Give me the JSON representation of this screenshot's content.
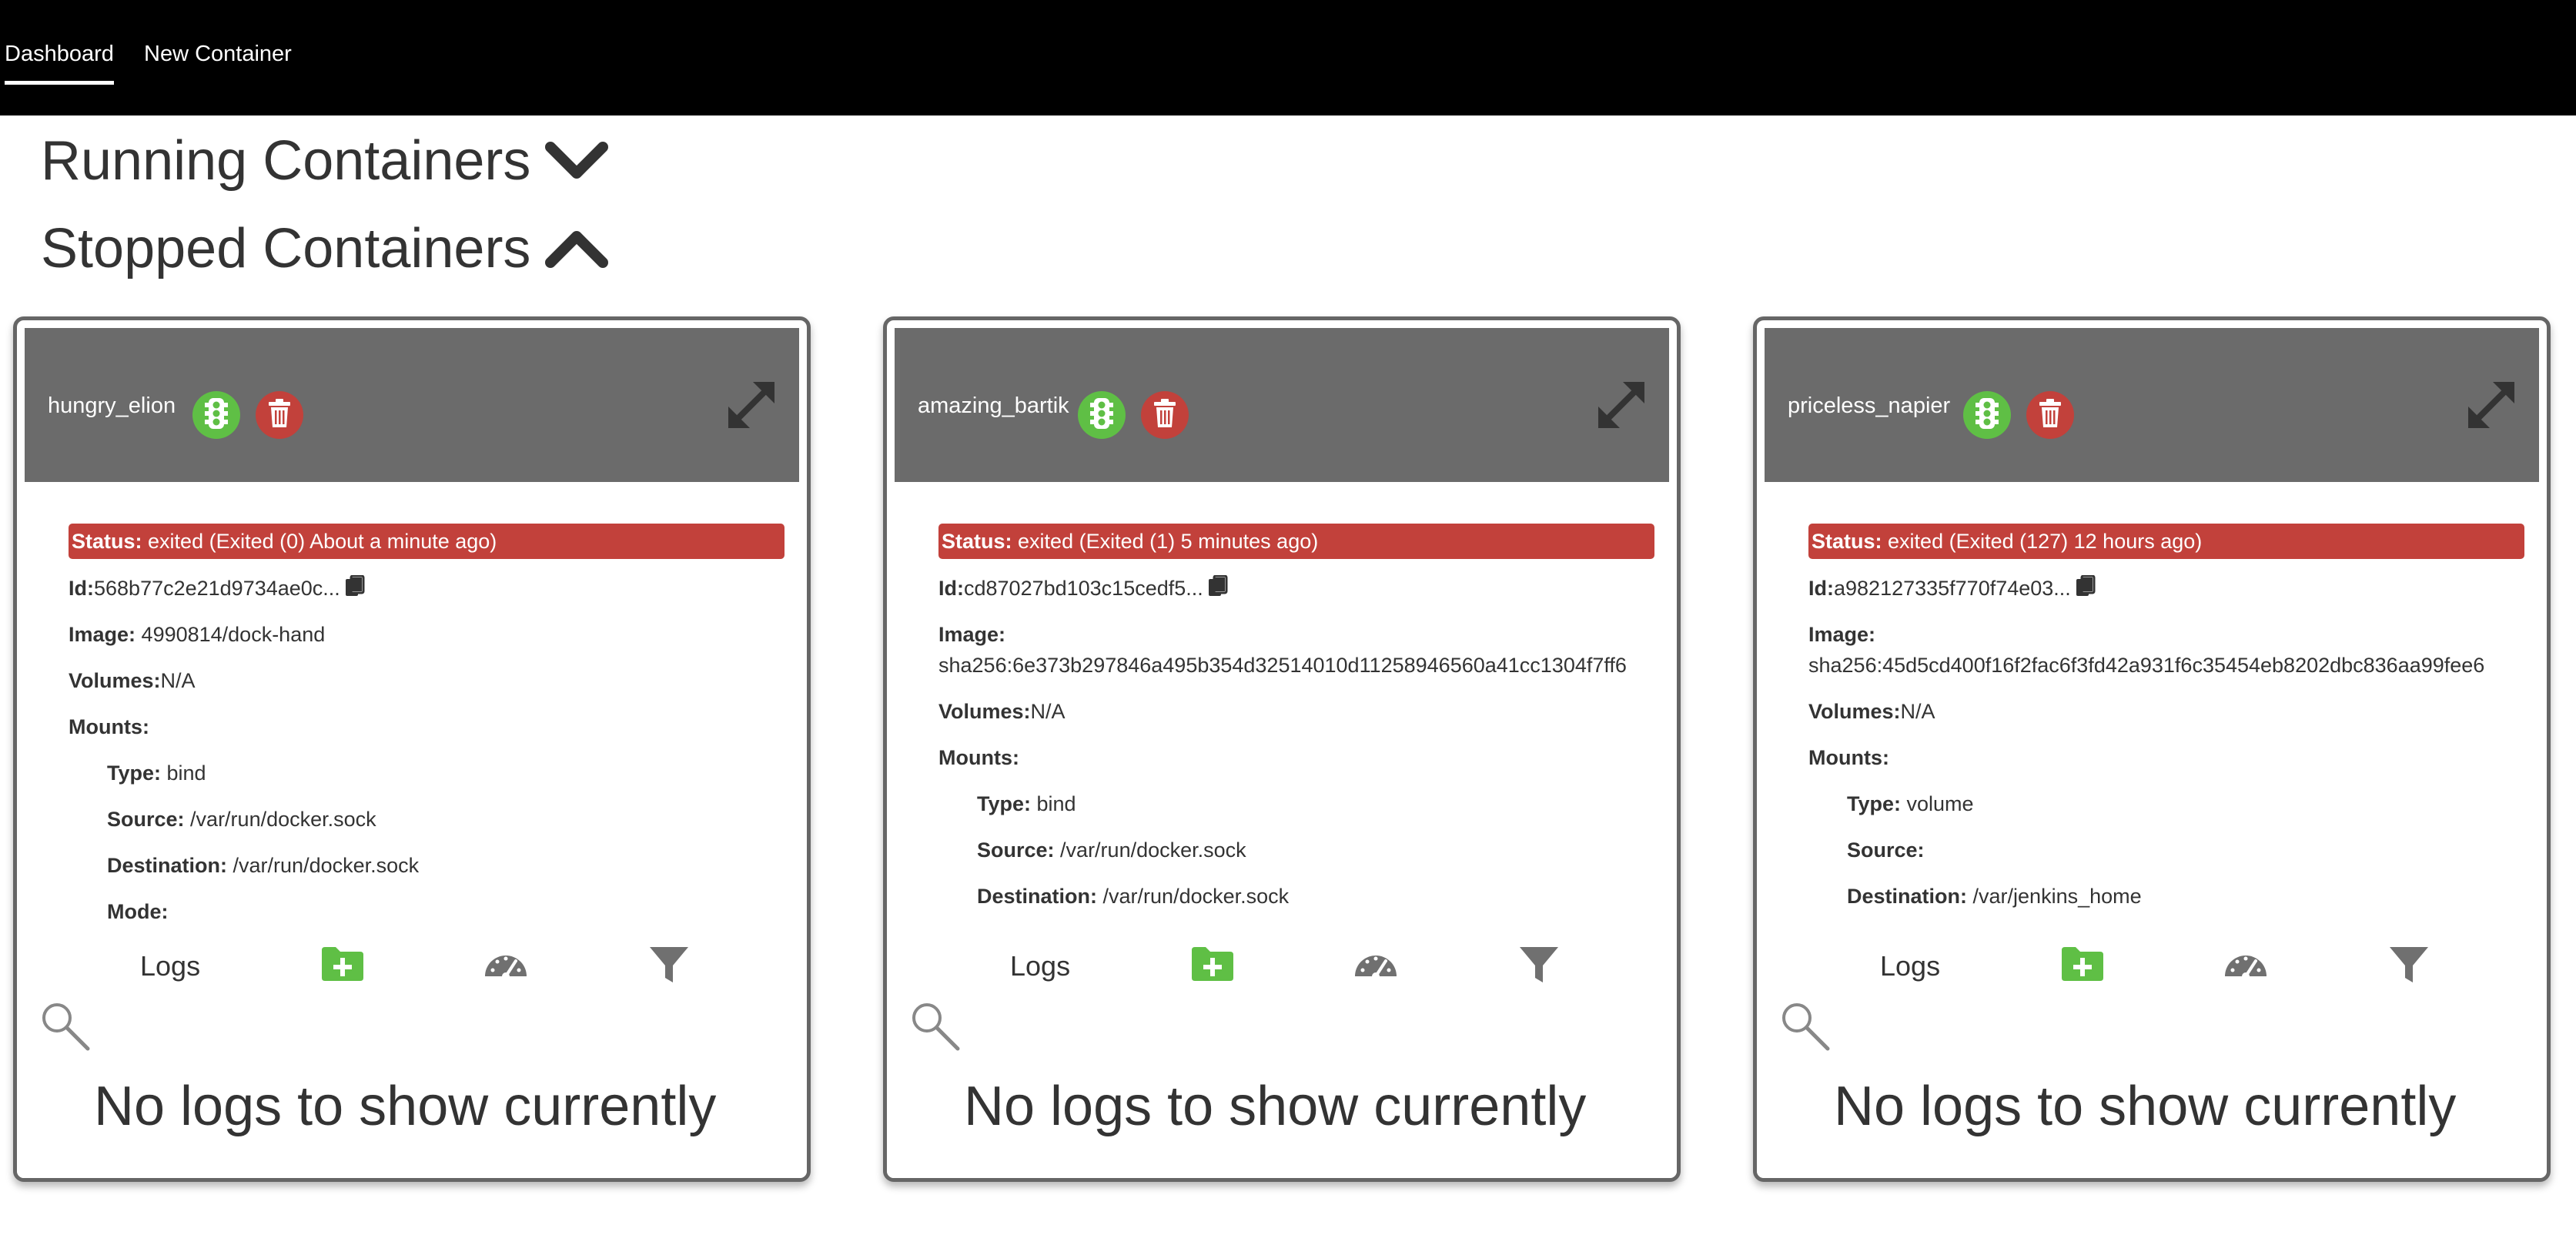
{
  "nav": {
    "dashboard_label": "Dashboard",
    "new_container_label": "New Container"
  },
  "sections": {
    "running": "Running Containers",
    "stopped": "Stopped Containers"
  },
  "labels": {
    "status": "Status:",
    "id": "Id:",
    "image": "Image:",
    "volumes": "Volumes:",
    "mounts": "Mounts:",
    "type": "Type:",
    "source": "Source:",
    "destination": "Destination:",
    "mode": "Mode:",
    "logs": "Logs",
    "no_logs": "No logs to show currently"
  },
  "colors": {
    "status_exited": "#c2413b",
    "start_button": "#5fbf45",
    "delete_button": "#c2413b",
    "card_header": "#6b6b6b",
    "nav_bg": "#000000"
  },
  "containers": [
    {
      "name": "hungry_elion",
      "status": "exited (Exited (0) About a minute ago)",
      "id": "568b77c2e21d9734ae0c...",
      "image": "4990814/dock-hand",
      "volumes": "N/A",
      "mount_type": "bind",
      "mount_source": "/var/run/docker.sock",
      "mount_destination": "/var/run/docker.sock",
      "mount_mode": ""
    },
    {
      "name": "amazing_bartik",
      "status": "exited (Exited (1) 5 minutes ago)",
      "id": "cd87027bd103c15cedf5...",
      "image": "sha256:6e373b297846a495b354d32514010d11258946560a41cc1304f7ff6",
      "volumes": "N/A",
      "mount_type": "bind",
      "mount_source": "/var/run/docker.sock",
      "mount_destination": "/var/run/docker.sock",
      "mount_mode": ""
    },
    {
      "name": "priceless_napier",
      "status": "exited (Exited (127) 12 hours ago)",
      "id": "a982127335f770f74e03...",
      "image": "sha256:45d5cd400f16f2fac6f3fd42a931f6c35454eb8202dbc836aa99fee6",
      "volumes": "N/A",
      "mount_type": "volume",
      "mount_source": "",
      "mount_destination": "/var/jenkins_home",
      "mount_mode": ""
    }
  ]
}
